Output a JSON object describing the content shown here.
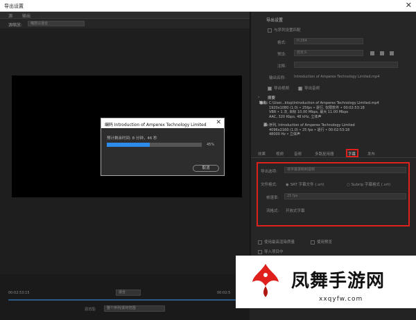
{
  "window": {
    "title": "导出设置"
  },
  "left_tabs": [
    "源",
    "输出"
  ],
  "source": {
    "label": "源缩放:",
    "value": "缩放以适合"
  },
  "encode_dialog": {
    "title": "编码 Introduction of Amperex Technology Limited",
    "status": "预计剩余时间: 8 分钟，46 秒",
    "progress_percent": 45,
    "percent_label": "45%",
    "cancel_label": "取消"
  },
  "timeline": {
    "tc_in": "00:02:53:15",
    "tc_out": "00:02:5",
    "fit_label": "适合",
    "range_label": "源范围:",
    "range_value": "整个序列/素材范围"
  },
  "export_settings": {
    "header": "导出设置",
    "match_seq": "与序列设置匹配",
    "format_label": "格式:",
    "format_value": "H.264",
    "preset_label": "预设:",
    "preset_value": "自定义",
    "comment_label": "注释:",
    "output_label": "输出名称:",
    "output_value": "Introduction of Amperex Technology Limited.mp4",
    "export_video": "导出视频",
    "export_audio": "导出音频"
  },
  "summary": {
    "header": "摘要",
    "output_label": "输出:",
    "output_lines": [
      "C:\\User...ktop\\Introduction of Amperex Technology Limited.mp4",
      "1920x1080 (1.0) • 25fps • 逐行, 仅限软件 • 00:02:53:18",
      "VBR • 1 次, 目标 10.00 Mbps, 最大 11.00 Mbps",
      "AAC, 320 Kbps, 48 kHz, 立体声"
    ],
    "source_label": "源:",
    "source_lines": [
      "序列, Introduction of Amperex Technology Limited",
      "4096x2160 (1.0) • 25 fps • 逐行 • 00:02:53:18",
      "48000 Hz • 立体声"
    ]
  },
  "right_tabs": [
    "效果",
    "视频",
    "音频",
    "多路复用器",
    "字幕",
    "发布"
  ],
  "captions": {
    "export_option_label": "导出选项:",
    "export_option_value": "将字幕录制到视频",
    "file_format_label": "文件格式:",
    "file_format_opt1": "SRT 字幕文件 (.srt)",
    "file_format_opt2": "Subrip 字幕格式 (.srt)",
    "frame_rate_label": "帧速率:",
    "frame_rate_value": "25 fps",
    "stream_label": "流格式:",
    "stream_value": "开放式字幕"
  },
  "bottom_opts": {
    "max_render": "使用最高渲染质量",
    "use_preview": "使用预览",
    "import_project": "导入项目中"
  },
  "watermark": {
    "name": "凤舞手游网",
    "url": "xxqyfw.com"
  },
  "colors": {
    "accent": "#2d8ceb",
    "highlight": "#e0201c"
  }
}
